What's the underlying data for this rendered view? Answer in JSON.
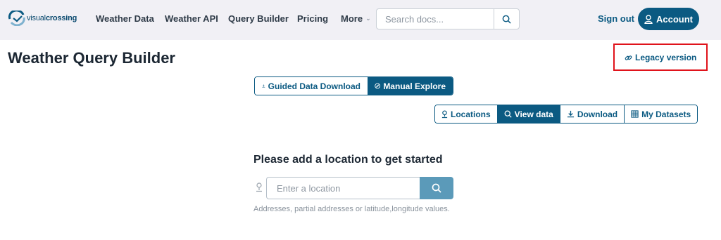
{
  "brand": {
    "logo_light": "visual",
    "logo_bold": "crossing"
  },
  "nav": {
    "items": [
      {
        "label": "Weather Data"
      },
      {
        "label": "Weather API"
      },
      {
        "label": "Query Builder"
      },
      {
        "label": "Pricing"
      },
      {
        "label": "More"
      }
    ],
    "search_placeholder": "Search docs...",
    "signout_label": "Sign out",
    "account_label": "Account"
  },
  "page": {
    "title": "Weather Query Builder",
    "legacy_label": "Legacy version"
  },
  "modes": [
    {
      "label": "Guided Data Download",
      "icon": "download-icon",
      "active": false
    },
    {
      "label": "Manual Explore",
      "icon": "compass-icon",
      "active": true
    }
  ],
  "view_tabs": [
    {
      "label": "Locations",
      "icon": "pin-icon",
      "active": false
    },
    {
      "label": "View data",
      "icon": "search-icon",
      "active": true
    },
    {
      "label": "Download",
      "icon": "download-icon",
      "active": false
    },
    {
      "label": "My Datasets",
      "icon": "grid-icon",
      "active": false
    }
  ],
  "location": {
    "prompt": "Please add a location to get started",
    "placeholder": "Enter a location",
    "hint": "Addresses, partial addresses or latitude,longitude values."
  },
  "colors": {
    "primary": "#0b5a82",
    "search_button": "#5b9ab9",
    "highlight": "#e0131b",
    "nav_bg": "#f1f0f5"
  }
}
